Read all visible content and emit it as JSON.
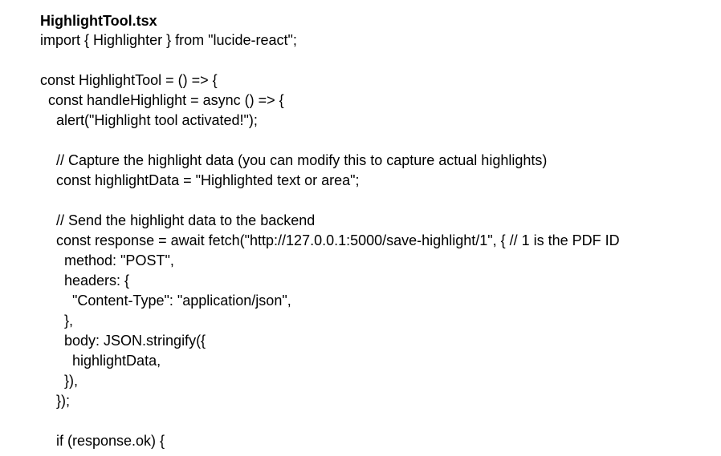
{
  "document": {
    "filename": "HighlightTool.tsx",
    "lines": [
      "import { Highlighter } from \"lucide-react\";",
      "",
      "const HighlightTool = () => {",
      "  const handleHighlight = async () => {",
      "    alert(\"Highlight tool activated!\");",
      "",
      "    // Capture the highlight data (you can modify this to capture actual highlights)",
      "    const highlightData = \"Highlighted text or area\";",
      "",
      "    // Send the highlight data to the backend",
      "    const response = await fetch(\"http://127.0.0.1:5000/save-highlight/1\", { // 1 is the PDF ID",
      "      method: \"POST\",",
      "      headers: {",
      "        \"Content-Type\": \"application/json\",",
      "      },",
      "      body: JSON.stringify({",
      "        highlightData,",
      "      }),",
      "    });",
      "",
      "    if (response.ok) {"
    ]
  }
}
